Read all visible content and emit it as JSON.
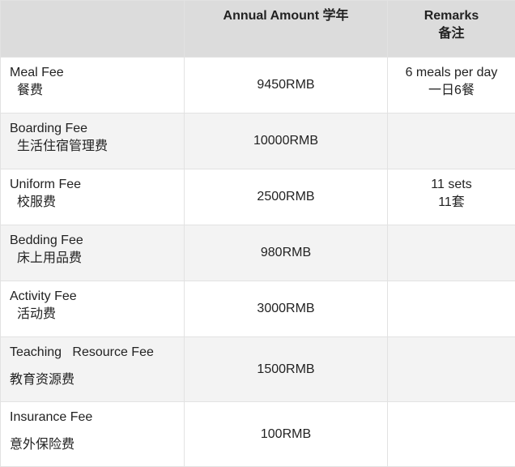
{
  "header": {
    "item": "",
    "amount": "Annual   Amount 学年",
    "remarks_en": "Remarks",
    "remarks_zh": "备注"
  },
  "rows": [
    {
      "name_en": "Meal Fee",
      "name_zh": "餐费",
      "amount": "9450RMB",
      "remark_en": "6 meals per day",
      "remark_zh": "一日6餐"
    },
    {
      "name_en": "Boarding Fee",
      "name_zh": "生活住宿管理费",
      "amount": "10000RMB",
      "remark_en": "",
      "remark_zh": ""
    },
    {
      "name_en": "Uniform Fee",
      "name_zh": "校服费",
      "amount": "2500RMB",
      "remark_en": "11 sets",
      "remark_zh": "11套"
    },
    {
      "name_en": "Bedding Fee",
      "name_zh": "床上用品费",
      "amount": "980RMB",
      "remark_en": "",
      "remark_zh": ""
    },
    {
      "name_en": "Activity Fee",
      "name_zh": "活动费",
      "amount": "3000RMB",
      "remark_en": "",
      "remark_zh": ""
    },
    {
      "name_en": "Teaching   Resource Fee",
      "name_zh": "教育资源费",
      "amount": "1500RMB",
      "remark_en": "",
      "remark_zh": ""
    },
    {
      "name_en": "Insurance Fee",
      "name_zh": "意外保险费",
      "amount": "100RMB",
      "remark_en": "",
      "remark_zh": ""
    }
  ]
}
